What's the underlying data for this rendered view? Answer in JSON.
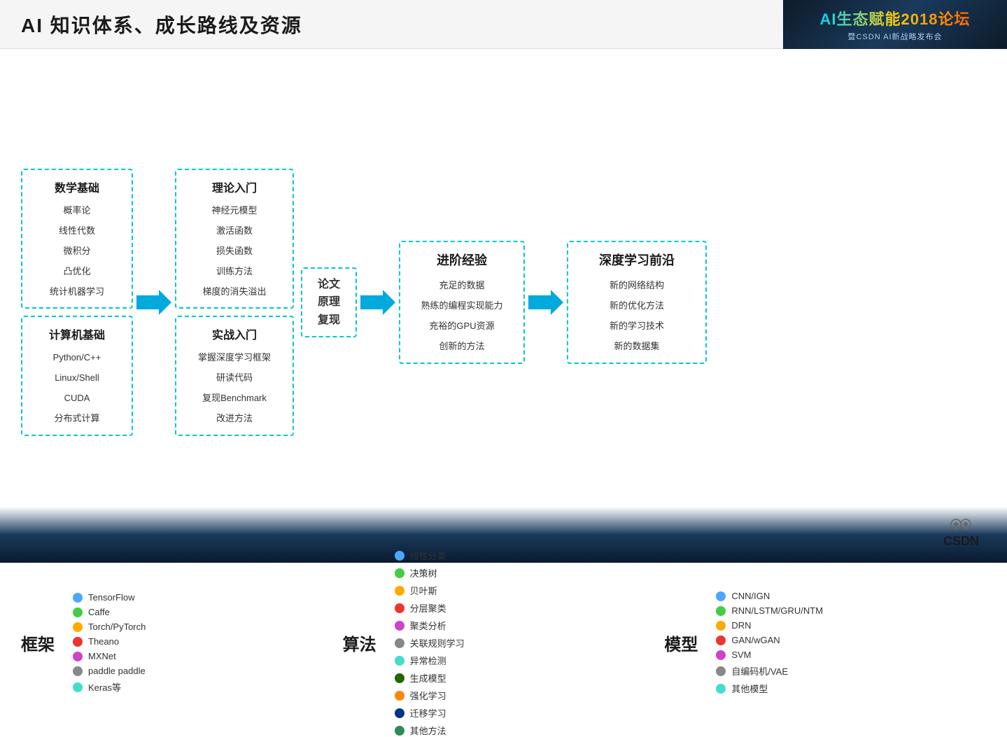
{
  "header": {
    "title": "AI 知识体系、成长路线及资源"
  },
  "logo": {
    "main": "AI生态赋能2018论坛",
    "sub": "暨CSDN AI新战略发布会"
  },
  "flow": {
    "math_box": {
      "title": "数学基础",
      "items": [
        "概率论",
        "线性代数",
        "微积分",
        "凸优化",
        "统计机器学习"
      ]
    },
    "computer_box": {
      "title": "计算机基础",
      "items": [
        "Python/C++",
        "Linux/Shell",
        "CUDA",
        "分布式计算"
      ]
    },
    "theory_box": {
      "title": "理论入门",
      "items": [
        "神经元模型",
        "激活函数",
        "损失函数",
        "训练方法",
        "梯度的消失溢出"
      ]
    },
    "practical_box": {
      "title": "实战入门",
      "items": [
        "掌握深度学习框架",
        "研读代码",
        "复现Benchmark",
        "改进方法"
      ]
    },
    "paper_box": {
      "lines": [
        "论文",
        "原理",
        "复现"
      ]
    },
    "advanced_box": {
      "title": "进阶经验",
      "items": [
        "充足的数据",
        "熟练的编程实现能力",
        "充裕的GPU资源",
        "创新的方法"
      ]
    },
    "deep_box": {
      "title": "深度学习前沿",
      "items": [
        "新的网络结构",
        "新的优化方法",
        "新的学习技术",
        "新的数据集"
      ]
    }
  },
  "frameworks": {
    "label": "框架",
    "items": [
      {
        "color": "#4da6ff",
        "name": "TensorFlow"
      },
      {
        "color": "#44cc44",
        "name": "Caffe"
      },
      {
        "color": "#ffaa00",
        "name": "Torch/PyTorch"
      },
      {
        "color": "#ee3333",
        "name": "Theano"
      },
      {
        "color": "#cc44cc",
        "name": "MXNet"
      },
      {
        "color": "#888888",
        "name": "paddle paddle"
      },
      {
        "color": "#44ddcc",
        "name": "Keras等"
      }
    ]
  },
  "algorithms": {
    "label": "算法",
    "items": [
      {
        "color": "#4da6ff",
        "name": "线性分类"
      },
      {
        "color": "#44cc44",
        "name": "决策树"
      },
      {
        "color": "#ffaa00",
        "name": "贝叶斯"
      },
      {
        "color": "#ee3333",
        "name": "分层聚类"
      },
      {
        "color": "#cc44cc",
        "name": "聚类分析"
      },
      {
        "color": "#888888",
        "name": "关联规则学习"
      },
      {
        "color": "#44ddcc",
        "name": "异常检测"
      },
      {
        "color": "#226600",
        "name": "生成模型"
      },
      {
        "color": "#ff8800",
        "name": "强化学习"
      },
      {
        "color": "#003388",
        "name": "迁移学习"
      },
      {
        "color": "#338855",
        "name": "其他方法"
      }
    ]
  },
  "models": {
    "label": "模型",
    "items": [
      {
        "color": "#4da6ff",
        "name": "CNN/IGN"
      },
      {
        "color": "#44cc44",
        "name": "RNN/LSTM/GRU/NTM"
      },
      {
        "color": "#ffaa00",
        "name": "DRN"
      },
      {
        "color": "#ee3333",
        "name": "GAN/wGAN"
      },
      {
        "color": "#cc44cc",
        "name": "SVM"
      },
      {
        "color": "#888888",
        "name": "自编码机/VAE"
      },
      {
        "color": "#44ddcc",
        "name": "其他模型"
      }
    ]
  },
  "csdn": {
    "label": "CSDN"
  }
}
